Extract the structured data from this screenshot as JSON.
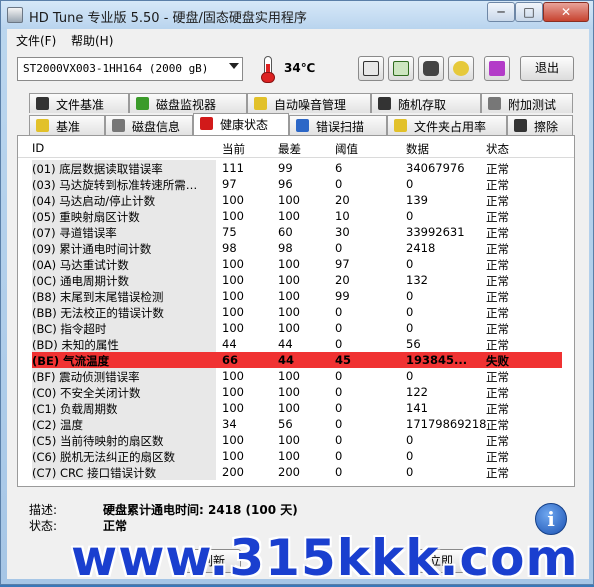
{
  "window": {
    "title": "HD Tune 专业版 5.50 - 硬盘/固态硬盘实用程序",
    "min_label": "─",
    "max_label": "□",
    "close_label": "✕"
  },
  "menu": {
    "file": "文件(F)",
    "help": "帮助(H)"
  },
  "toolbar": {
    "drive": "ST2000VX003-1HH164 (2000 gB)",
    "temperature": "34℃",
    "exit_label": "退出",
    "icons": [
      "copy-info-icon",
      "copy-screenshot-icon",
      "camera-icon",
      "options-icon",
      "download-icon"
    ]
  },
  "tabs_top": [
    "文件基准",
    "磁盘监视器",
    "自动噪音管理",
    "随机存取",
    "附加测试"
  ],
  "tabs_bottom": [
    "基准",
    "磁盘信息",
    "健康状态",
    "错误扫描",
    "文件夹占用率",
    "擦除"
  ],
  "active_tab": "健康状态",
  "columns": [
    "ID",
    "当前",
    "最差",
    "阈值",
    "数据",
    "状态"
  ],
  "rows": [
    {
      "id": "(01) 底层数据读取错误率",
      "current": "111",
      "worst": "99",
      "threshold": "6",
      "data": "34067976",
      "status": "正常"
    },
    {
      "id": "(03) 马达旋转到标准转速所需…",
      "current": "97",
      "worst": "96",
      "threshold": "0",
      "data": "0",
      "status": "正常"
    },
    {
      "id": "(04) 马达启动/停止计数",
      "current": "100",
      "worst": "100",
      "threshold": "20",
      "data": "139",
      "status": "正常"
    },
    {
      "id": "(05) 重映射扇区计数",
      "current": "100",
      "worst": "100",
      "threshold": "10",
      "data": "0",
      "status": "正常"
    },
    {
      "id": "(07) 寻道错误率",
      "current": "75",
      "worst": "60",
      "threshold": "30",
      "data": "33992631",
      "status": "正常"
    },
    {
      "id": "(09) 累计通电时间计数",
      "current": "98",
      "worst": "98",
      "threshold": "0",
      "data": "2418",
      "status": "正常"
    },
    {
      "id": "(0A) 马达重试计数",
      "current": "100",
      "worst": "100",
      "threshold": "97",
      "data": "0",
      "status": "正常"
    },
    {
      "id": "(0C) 通电周期计数",
      "current": "100",
      "worst": "100",
      "threshold": "20",
      "data": "132",
      "status": "正常"
    },
    {
      "id": "(B8) 末尾到末尾错误检测",
      "current": "100",
      "worst": "100",
      "threshold": "99",
      "data": "0",
      "status": "正常"
    },
    {
      "id": "(BB) 无法校正的错误计数",
      "current": "100",
      "worst": "100",
      "threshold": "0",
      "data": "0",
      "status": "正常"
    },
    {
      "id": "(BC) 指令超时",
      "current": "100",
      "worst": "100",
      "threshold": "0",
      "data": "0",
      "status": "正常"
    },
    {
      "id": "(BD) 未知的属性",
      "current": "44",
      "worst": "44",
      "threshold": "0",
      "data": "56",
      "status": "正常"
    },
    {
      "id": "(BE) 气流温度",
      "current": "66",
      "worst": "44",
      "threshold": "45",
      "data": "193845...",
      "status": "失败"
    },
    {
      "id": "(BF) 震动侦测错误率",
      "current": "100",
      "worst": "100",
      "threshold": "0",
      "data": "0",
      "status": "正常"
    },
    {
      "id": "(C0) 不安全关闭计数",
      "current": "100",
      "worst": "100",
      "threshold": "0",
      "data": "122",
      "status": "正常"
    },
    {
      "id": "(C1) 负载周期数",
      "current": "100",
      "worst": "100",
      "threshold": "0",
      "data": "141",
      "status": "正常"
    },
    {
      "id": "(C2) 温度",
      "current": "34",
      "worst": "56",
      "threshold": "0",
      "data": "17179869218",
      "status": "正常"
    },
    {
      "id": "(C5) 当前待映射的扇区数",
      "current": "100",
      "worst": "100",
      "threshold": "0",
      "data": "0",
      "status": "正常"
    },
    {
      "id": "(C6) 脱机无法纠正的扇区数",
      "current": "100",
      "worst": "100",
      "threshold": "0",
      "data": "0",
      "status": "正常"
    },
    {
      "id": "(C7) CRC 接口错误计数",
      "current": "200",
      "worst": "200",
      "threshold": "0",
      "data": "0",
      "status": "正常"
    }
  ],
  "description": {
    "desc_label": "描述:",
    "desc_value": "硬盘累计通电时间: 2418 (100 天)",
    "status_label": "状态:",
    "status_value": "正常"
  },
  "bottom": {
    "refresh_label": "刷新",
    "immediate_label": "立即"
  },
  "watermark": "www.315kkk.com",
  "colors": {
    "fail_row": "#f03232",
    "window_frame": "#bcd7ef",
    "watermark": "#1a3fcf"
  }
}
